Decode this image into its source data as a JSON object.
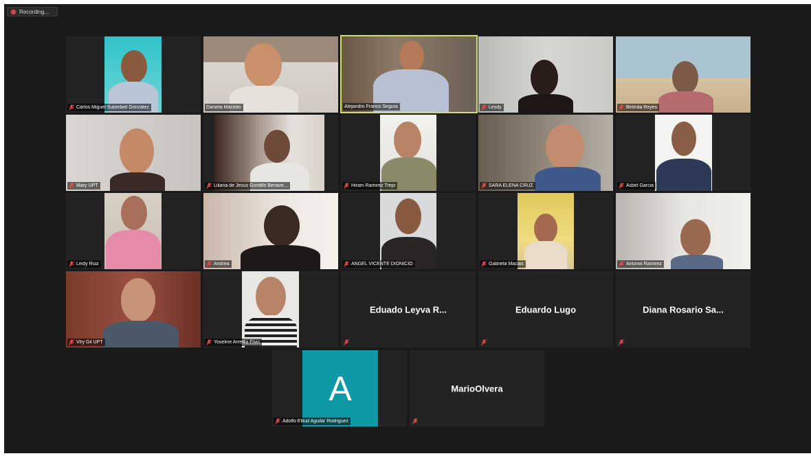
{
  "recording": {
    "label": "Recording..."
  },
  "participants": [
    {
      "name": "Carlos Miguel Suberbiel González"
    },
    {
      "name": "Daniela Macedo"
    },
    {
      "name": "Alejandro Franco Segura"
    },
    {
      "name": "Lesdy"
    },
    {
      "name": "Belinda Reyes"
    },
    {
      "name": "Mary UPT"
    },
    {
      "name": "Liliana de Jesus Gordillo Benave..."
    },
    {
      "name": "Hiram Ramirez Trejo"
    },
    {
      "name": "SARA ELENA CRUZ"
    },
    {
      "name": "Asbel Garcia"
    },
    {
      "name": "Leidy Ruiz"
    },
    {
      "name": "Andrea"
    },
    {
      "name": "ANGEL VICENTE DIONICIO"
    },
    {
      "name": "Gabriela Macias"
    },
    {
      "name": "Antonio Ramirez"
    },
    {
      "name": "Vlry Gil UPT"
    },
    {
      "name": "Yoseline Arreola Elias"
    },
    {
      "display": "Eduado Leyva R..."
    },
    {
      "display": "Eduardo Lugo"
    },
    {
      "display": "Diana Rosario Sa..."
    },
    {
      "name": "Adolfo Elliud Aguilar Rodriguez",
      "avatar_letter": "A"
    },
    {
      "display": "MarioOlvera"
    }
  ]
}
